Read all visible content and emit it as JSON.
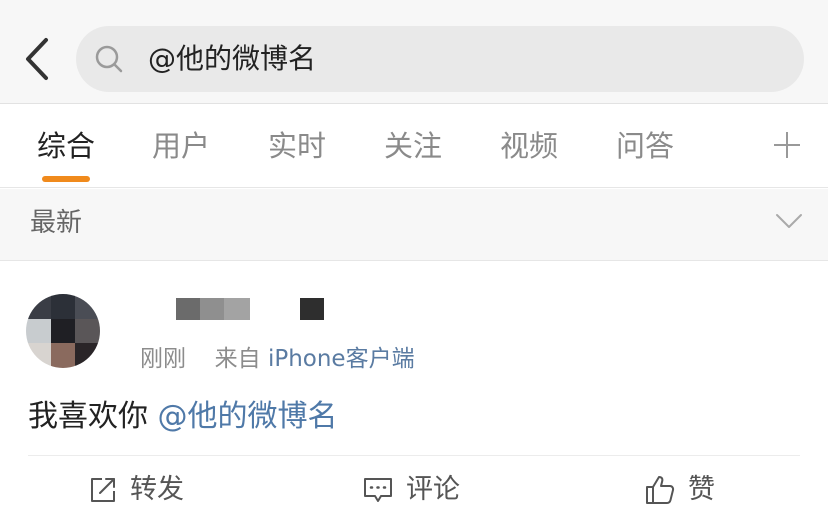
{
  "header": {
    "back_icon": "chevron-left-icon",
    "search_icon": "search-icon",
    "search_value": "@他的微博名"
  },
  "tabs": [
    {
      "label": "综合",
      "active": true
    },
    {
      "label": "用户",
      "active": false
    },
    {
      "label": "实时",
      "active": false
    },
    {
      "label": "关注",
      "active": false
    },
    {
      "label": "视频",
      "active": false
    },
    {
      "label": "问答",
      "active": false
    }
  ],
  "tabs_more_icon": "plus-icon",
  "accent_color": "#f08a1c",
  "sort": {
    "label": "最新",
    "icon": "chevron-down-icon"
  },
  "post": {
    "time": "刚刚",
    "source_prefix": "来自",
    "source": "iPhone客户端",
    "text": "我喜欢你",
    "mention": "@他的微博名",
    "link_color": "#4f79a8",
    "actions": {
      "repost": "转发",
      "comment": "评论",
      "like": "赞"
    }
  }
}
